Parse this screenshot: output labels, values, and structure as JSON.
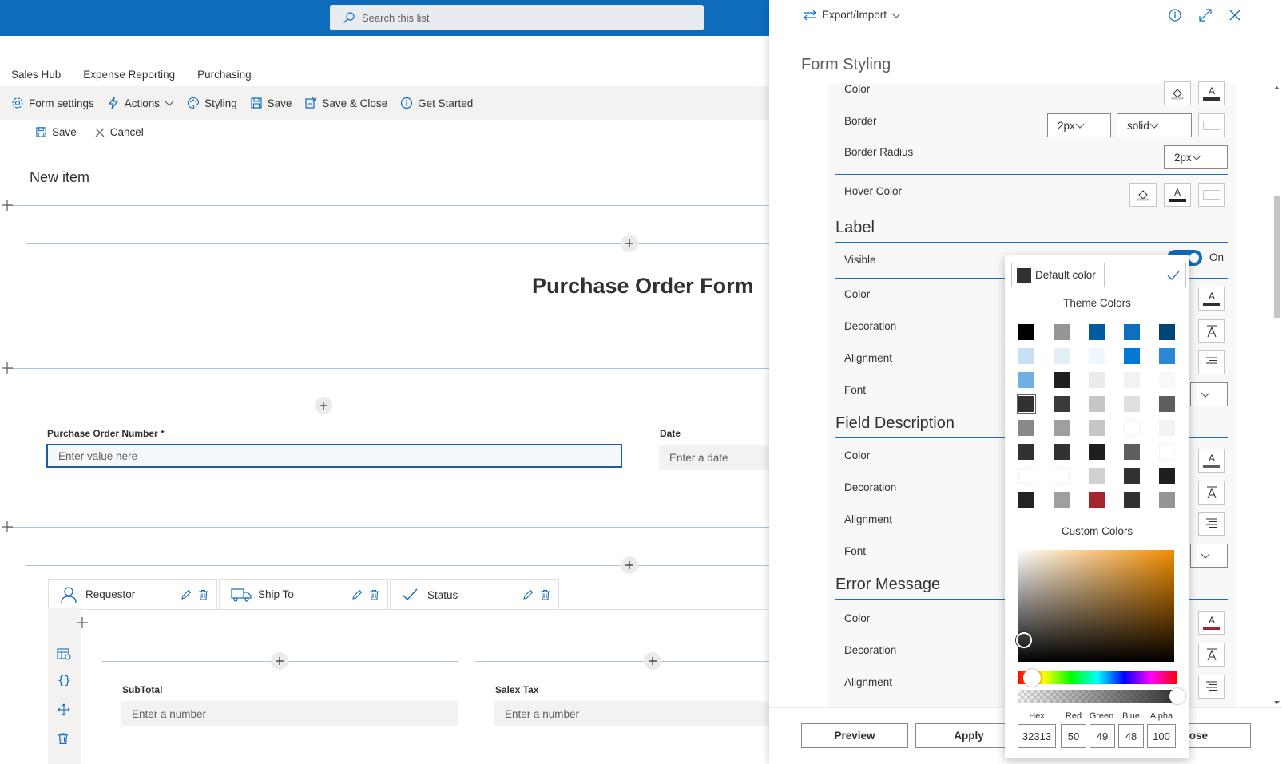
{
  "search": {
    "placeholder": "Search this list"
  },
  "site_nav": [
    "Sales Hub",
    "Expense Reporting",
    "Purchasing"
  ],
  "command_bar": {
    "form_settings": "Form settings",
    "actions": "Actions",
    "styling": "Styling",
    "save": "Save",
    "save_close": "Save & Close",
    "get_started": "Get Started"
  },
  "form_commands": {
    "save": "Save",
    "cancel": "Cancel"
  },
  "form": {
    "new_item": "New item",
    "title": "Purchase Order Form",
    "po_number_label": "Purchase Order Number *",
    "po_number_placeholder": "Enter value here",
    "date_label": "Date",
    "date_placeholder": "Enter a date",
    "tabs": [
      {
        "label": "Requestor",
        "icon": "person-icon"
      },
      {
        "label": "Ship To",
        "icon": "truck-icon"
      },
      {
        "label": "Status",
        "icon": "checkmark-icon"
      }
    ],
    "subtotal_label": "SubTotal",
    "subtotal_placeholder": "Enter a number",
    "salestax_label": "Salex Tax",
    "salestax_placeholder": "Enter a number"
  },
  "panel": {
    "header": "Export/Import",
    "title": "Form Styling",
    "rows": {
      "color_top": "Color",
      "border": "Border",
      "border_width": "2px",
      "border_style": "solid",
      "border_radius": "Border Radius",
      "border_radius_value": "2px",
      "hover_color": "Hover Color"
    },
    "sections": {
      "label": "Label",
      "field_description": "Field Description",
      "error_message": "Error Message"
    },
    "label_rows": {
      "visible": "Visible",
      "toggle_state": "On",
      "color": "Color",
      "decoration": "Decoration",
      "alignment": "Alignment",
      "font": "Font"
    },
    "fd_rows": {
      "color": "Color",
      "decoration": "Decoration",
      "alignment": "Alignment",
      "font": "Font"
    },
    "em_rows": {
      "color": "Color",
      "decoration": "Decoration",
      "alignment": "Alignment"
    },
    "footer": {
      "preview": "Preview",
      "apply": "Apply",
      "close": "lose"
    }
  },
  "color_picker": {
    "default_color": "Default color",
    "theme_colors_label": "Theme Colors",
    "custom_colors_label": "Custom Colors",
    "swatches": [
      "#000000",
      "#979593",
      "#005a9e",
      "#106ebe",
      "#004578",
      "#c7e0f4",
      "#e1f0f5",
      "#eff6fc",
      "#0078d4",
      "#2b88d8",
      "#71afe5",
      "#201f1e",
      "#edebe9",
      "#f3f2f1",
      "#faf9f8",
      "#323130",
      "#3b3a39",
      "#c8c6c4",
      "#e1dfdd",
      "#605e5c",
      "#8a8886",
      "#a19f9d",
      "#c8c6c4",
      "#ffffff",
      "#f3f2f1",
      "#323130",
      "#323130",
      "#201f1e",
      "#605e5c",
      "#ffffff",
      "#ffffff",
      "#ffffff",
      "#d2d0ce",
      "#323130",
      "#201f1e",
      "#252423",
      "#a19f9d",
      "#a4262c",
      "#323130",
      "#979593"
    ],
    "selected_index": 15,
    "labels": {
      "hex": "Hex",
      "red": "Red",
      "green": "Green",
      "blue": "Blue",
      "alpha": "Alpha"
    },
    "values": {
      "hex": "32313",
      "red": "50",
      "green": "49",
      "blue": "48",
      "alpha": "100"
    }
  },
  "colors": {
    "brand": "#0f6cbd",
    "accent_line": "#1b6ec2",
    "error_red": "#a4262c"
  }
}
